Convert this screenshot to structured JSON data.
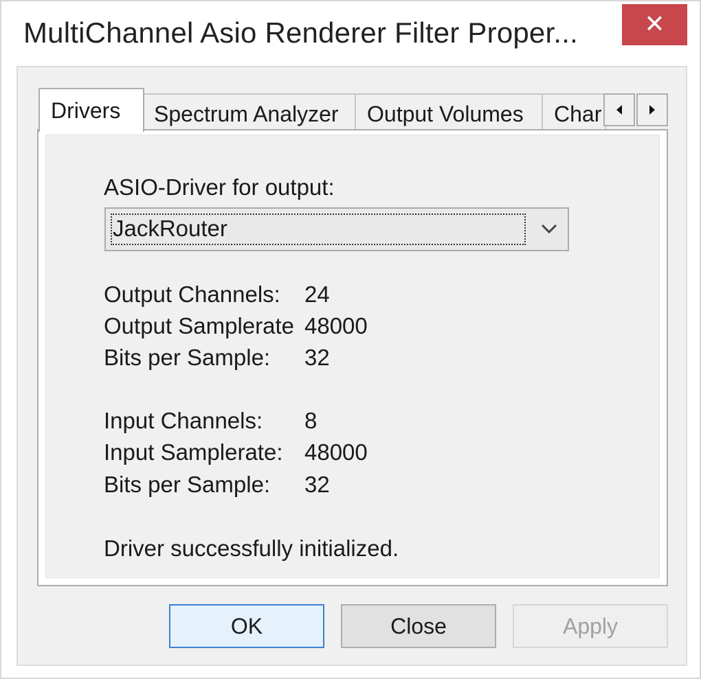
{
  "window": {
    "title": "MultiChannel Asio Renderer Filter Proper...",
    "close_icon": "close-icon",
    "close_glyph": "✕"
  },
  "tabs": [
    {
      "label": "Drivers",
      "active": true
    },
    {
      "label": "Spectrum Analyzer",
      "active": false
    },
    {
      "label": "Output Volumes",
      "active": false
    },
    {
      "label": "Char",
      "active": false
    }
  ],
  "tab_scroll": {
    "left_icon": "scroll-left-icon",
    "right_icon": "scroll-right-icon"
  },
  "drivers_page": {
    "driver_label": "ASIO-Driver for output:",
    "driver_select": {
      "value": "JackRouter",
      "icon": "chevron-down-icon"
    },
    "output": {
      "channels_label": "Output Channels:",
      "channels_value": "24",
      "samplerate_label": "Output Samplerate",
      "samplerate_value": "48000",
      "bits_label": "Bits per Sample:",
      "bits_value": "32"
    },
    "input": {
      "channels_label": "Input Channels:",
      "channels_value": "8",
      "samplerate_label": "Input Samplerate:",
      "samplerate_value": "48000",
      "bits_label": "Bits per Sample:",
      "bits_value": "32"
    },
    "status": "Driver successfully initialized."
  },
  "buttons": {
    "ok": "OK",
    "close": "Close",
    "apply": "Apply"
  },
  "colors": {
    "close_button": "#c7474c",
    "default_button_border": "#3c7fd6",
    "dialog_background": "#f0f0f0"
  }
}
